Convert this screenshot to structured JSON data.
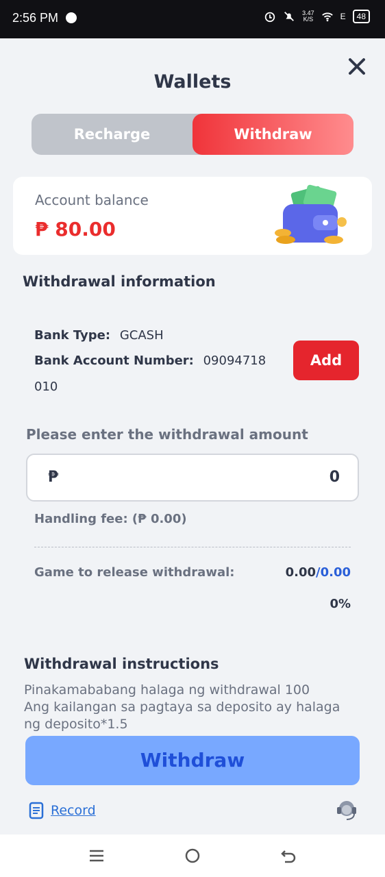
{
  "statusbar": {
    "time": "2:56 PM",
    "speed_top": "3.47",
    "speed_bottom": "K/S",
    "battery": "48",
    "signal_text": "E"
  },
  "header": {
    "title": "Wallets"
  },
  "tabs": {
    "recharge": "Recharge",
    "withdraw": "Withdraw"
  },
  "balance": {
    "label": "Account balance",
    "amount": "₱ 80.00"
  },
  "withdrawal_info": {
    "title": "Withdrawal information",
    "bank_type_label": "Bank Type:",
    "bank_type_value": "GCASH",
    "account_label": "Bank Account Number:",
    "account_value_line1": "09094718",
    "account_value_line2": "010",
    "add_label": "Add"
  },
  "amount": {
    "label": "Please enter the withdrawal amount",
    "currency": "₱",
    "value": "0"
  },
  "fee": {
    "text": "Handling fee: (₱ 0.00)"
  },
  "release": {
    "label": "Game to release withdrawal:",
    "current": "0.00",
    "separator": "/",
    "target": "0.00",
    "percent": "0%"
  },
  "instructions": {
    "title": "Withdrawal instructions",
    "lines": [
      "Pinakamababang halaga ng withdrawal 100",
      "Ang kailangan sa pagtaya sa deposito ay halaga",
      "ng deposito*1.5"
    ]
  },
  "actions": {
    "withdraw": "Withdraw",
    "record": "Record"
  },
  "icons": {
    "close": "close-icon",
    "wallet": "wallet-illustration",
    "record": "document-icon",
    "support": "headset-icon",
    "nav_menu": "menu-icon",
    "nav_home": "home-icon",
    "nav_back": "back-icon"
  },
  "colors": {
    "accent_red": "#e5252d",
    "withdraw_button": "#78a8ff",
    "blue_text": "#2a5fd8"
  }
}
